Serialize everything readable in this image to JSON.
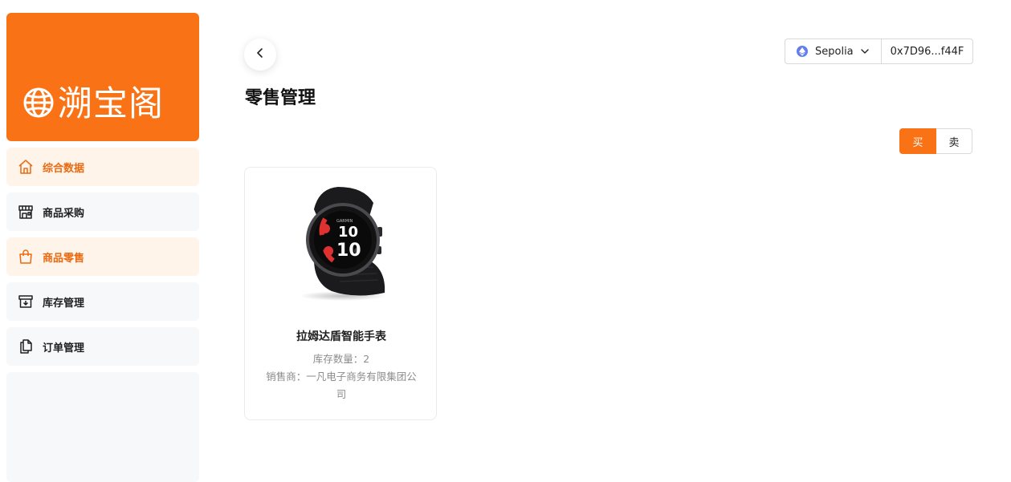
{
  "brand": {
    "name": "溯宝阁",
    "icon": "globe-icon",
    "color": "#f97316"
  },
  "sidebar": {
    "items": [
      {
        "label": "综合数据",
        "icon": "home-icon",
        "active": true
      },
      {
        "label": "商品采购",
        "icon": "store-icon",
        "active": false
      },
      {
        "label": "商品零售",
        "icon": "shopping-bag-icon",
        "active": true
      },
      {
        "label": "库存管理",
        "icon": "archive-box-icon",
        "active": false
      },
      {
        "label": "订单管理",
        "icon": "copy-documents-icon",
        "active": false
      }
    ]
  },
  "header": {
    "title": "零售管理",
    "back_icon": "chevron-left-icon"
  },
  "wallet": {
    "network": "Sepolia",
    "network_icon": "ethereum-icon",
    "address": "0x7D96...f44F"
  },
  "trade_toggle": {
    "buy_label": "买",
    "sell_label": "卖",
    "selected": "买"
  },
  "products": [
    {
      "name": "拉姆达盾智能手表",
      "stock_line": "库存数量：2",
      "seller_line": "销售商：一凡电子商务有限集团公司",
      "image": "smartwatch-image"
    }
  ],
  "colors": {
    "accent": "#f97316",
    "active_bg": "#fff4ea",
    "nav_bg": "#f7f8fa"
  }
}
